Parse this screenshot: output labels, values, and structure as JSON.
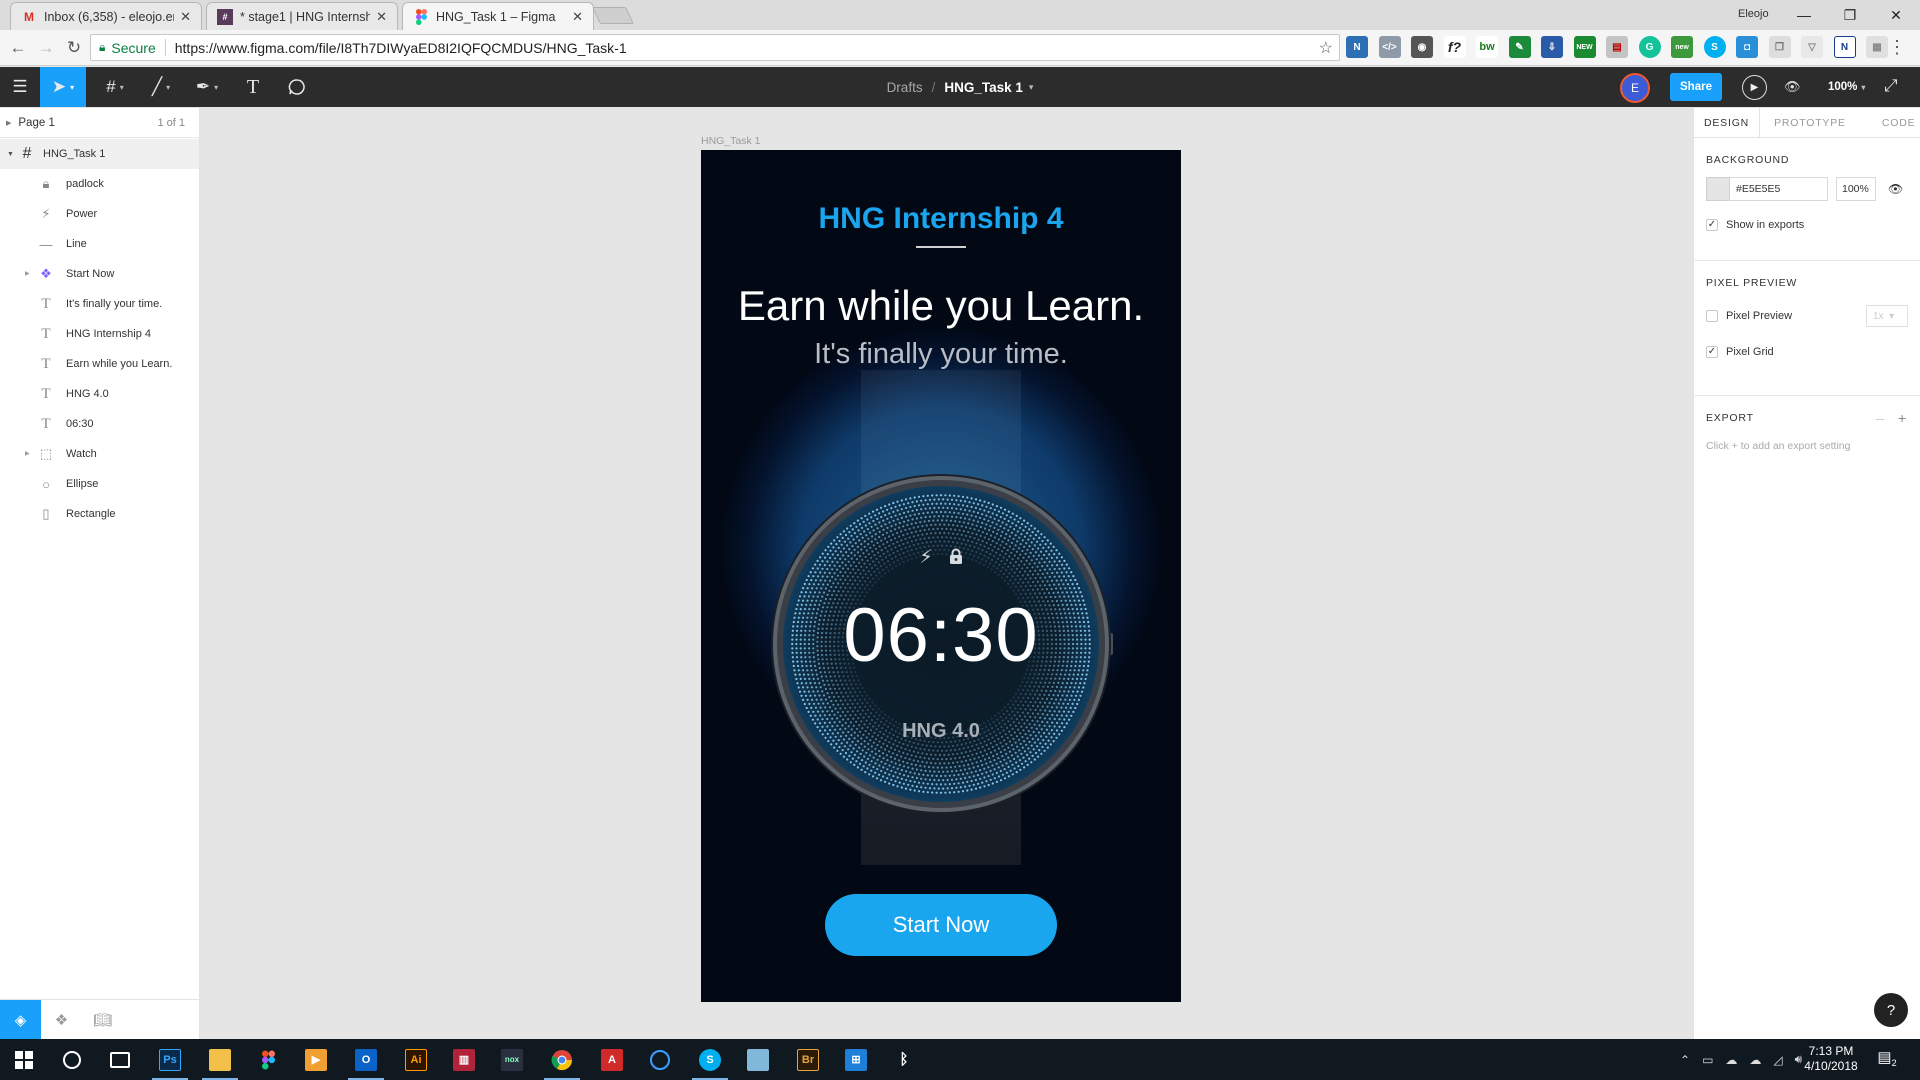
{
  "browser": {
    "tabs": [
      {
        "title": "Inbox (6,358) - eleojo.em",
        "favicon": "gmail-icon",
        "color": "#d93025"
      },
      {
        "title": "* stage1 | HNG Internshi",
        "favicon": "slack-icon",
        "color": "#5a3b5c"
      },
      {
        "title": "HNG_Task 1 – Figma",
        "favicon": "figma-icon",
        "color": "#f24e1e"
      }
    ],
    "profile_name": "Eleojo",
    "secure_label": "Secure",
    "url": "https://www.figma.com/file/I8Th7DIWyaED8I2IQFQCMDUS/HNG_Task-1",
    "extension_icons": [
      "extension-new-icon",
      "code-icon",
      "shield-icon",
      "formula-icon",
      "bw-icon",
      "color-picker-icon",
      "download-icon",
      "green-new-icon",
      "pdf-icon",
      "grammarly-icon",
      "new-badge-icon",
      "skype-icon",
      "box-icon",
      "copy-icon",
      "stack-icon",
      "notion-icon",
      "puzzle-icon"
    ]
  },
  "figma": {
    "breadcrumb_root": "Drafts",
    "breadcrumb_sep": "/",
    "file_name": "HNG_Task 1",
    "user_initial": "E",
    "share_label": "Share",
    "zoom": "100%"
  },
  "layers": {
    "page_label": "Page 1",
    "page_count": "1 of 1",
    "frame_name": "HNG_Task 1",
    "items": [
      {
        "name": "padlock",
        "icon": "lock-icon",
        "expandable": false
      },
      {
        "name": "Power",
        "icon": "bolt-icon",
        "expandable": false
      },
      {
        "name": "Line",
        "icon": "line-icon",
        "expandable": false
      },
      {
        "name": "Start Now",
        "icon": "component-icon",
        "expandable": true
      },
      {
        "name": "It's finally your time.",
        "icon": "text-icon",
        "expandable": false
      },
      {
        "name": "HNG Internship 4",
        "icon": "text-icon",
        "expandable": false
      },
      {
        "name": "Earn while you Learn.",
        "icon": "text-icon",
        "expandable": false
      },
      {
        "name": "HNG 4.0",
        "icon": "text-icon",
        "expandable": false
      },
      {
        "name": "06:30",
        "icon": "text-icon",
        "expandable": false
      },
      {
        "name": "Watch",
        "icon": "group-icon",
        "expandable": true
      },
      {
        "name": "Ellipse",
        "icon": "ellipse-icon",
        "expandable": false
      },
      {
        "name": "Rectangle",
        "icon": "rectangle-icon",
        "expandable": false
      }
    ]
  },
  "artboard": {
    "frame_label": "HNG_Task 1",
    "title": "HNG Internship 4",
    "headline": "Earn while you Learn.",
    "subhead": "It's finally your time.",
    "time": "06:30",
    "version": "HNG 4.0",
    "cta": "Start Now",
    "accent_color": "#1aa6ee",
    "background_color": "#020814"
  },
  "properties": {
    "tabs": [
      "DESIGN",
      "PROTOTYPE",
      "CODE"
    ],
    "active_tab": "DESIGN",
    "background_heading": "BACKGROUND",
    "bg_hex": "#E5E5E5",
    "bg_opacity": "100%",
    "show_in_exports": "Show in exports",
    "show_in_exports_checked": true,
    "pixel_preview_heading": "PIXEL PREVIEW",
    "pixel_preview": "Pixel Preview",
    "pixel_preview_checked": false,
    "pixel_scale": "1x",
    "pixel_grid": "Pixel Grid",
    "pixel_grid_checked": true,
    "export_heading": "EXPORT",
    "export_hint": "Click + to add an export setting",
    "help": "?"
  },
  "taskbar": {
    "apps": [
      "start-icon",
      "cortana-icon",
      "task-view-icon",
      "photoshop-icon",
      "file-explorer-icon",
      "figma-icon",
      "media-player-icon",
      "outlook-icon",
      "illustrator-icon",
      "winrar-icon",
      "nox-icon",
      "chrome-icon",
      "acrobat-icon",
      "browser-icon",
      "skype-icon",
      "notepad-icon",
      "bridge-icon",
      "windows-store-icon",
      "bluetooth-icon"
    ],
    "time": "7:13 PM",
    "date": "4/10/2018",
    "notification_count": "2"
  }
}
